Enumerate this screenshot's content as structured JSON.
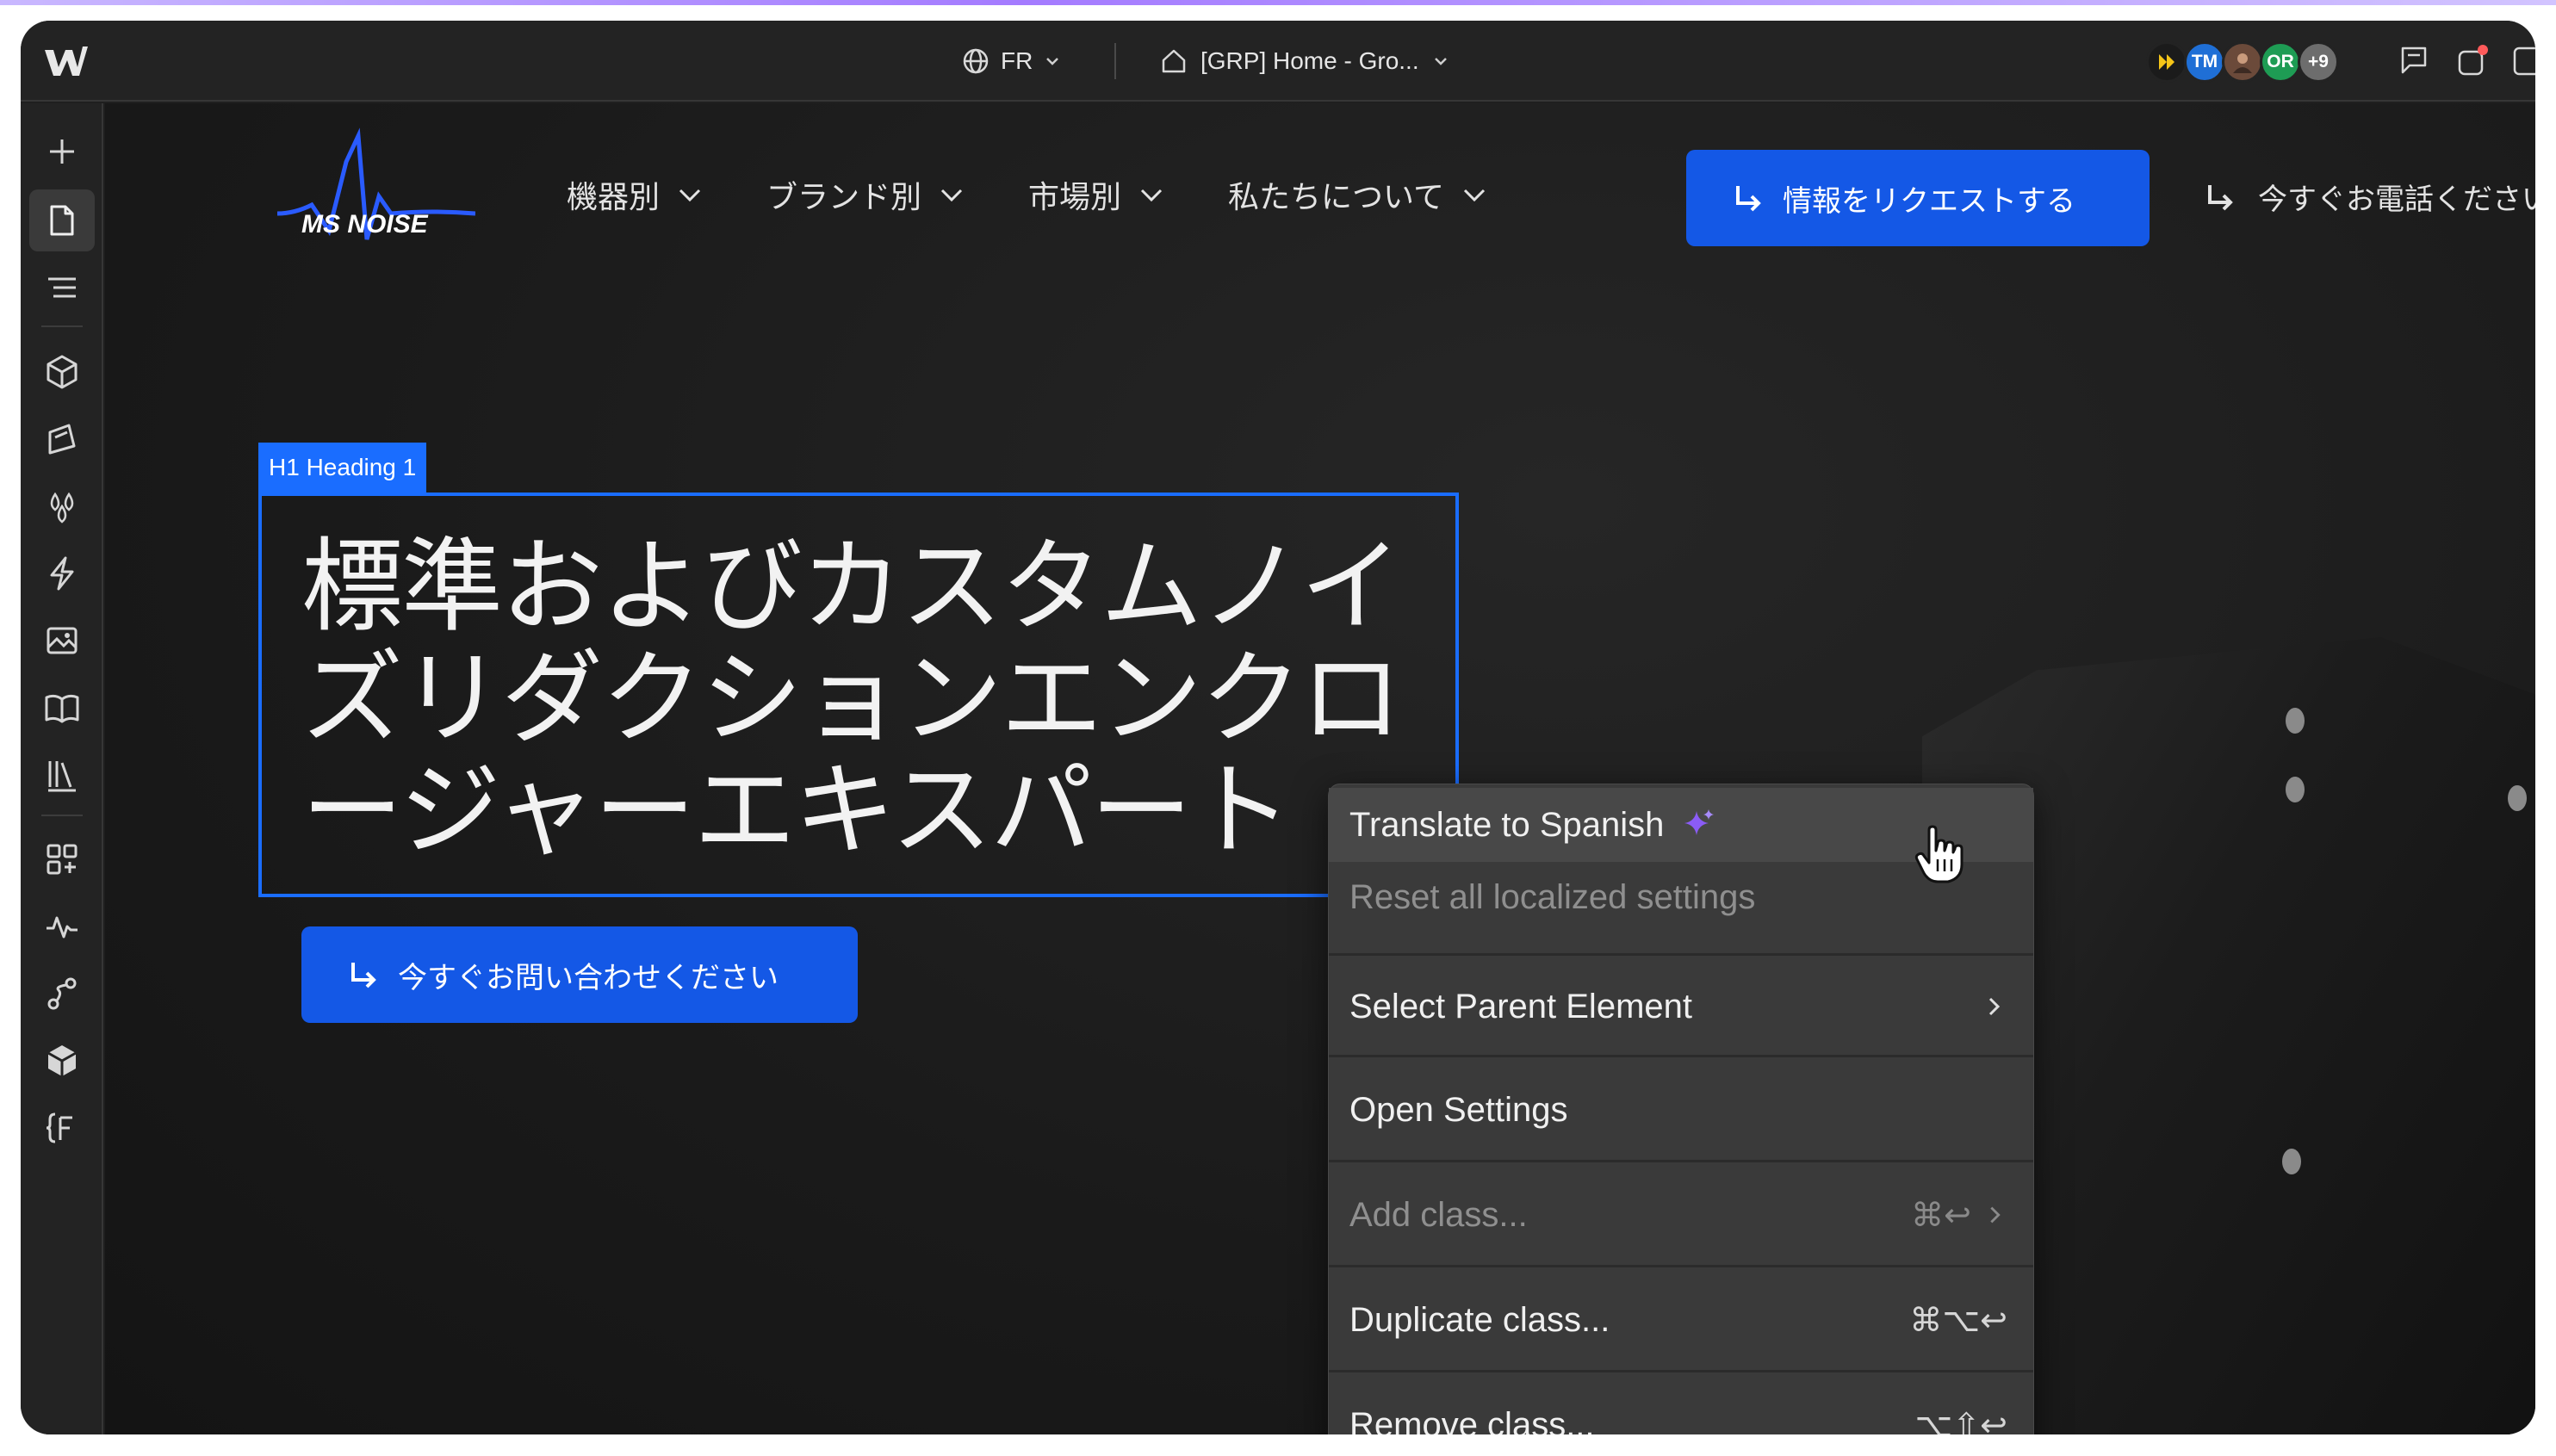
{
  "topbar": {
    "locale": "FR",
    "page_selector": "[GRP] Home - Gro...",
    "avatars": [
      {
        "initials": "",
        "color": "#1b1b1b"
      },
      {
        "initials": "TM",
        "color": "#1f6fd6"
      },
      {
        "initials": "",
        "color": "#6b4a3a"
      },
      {
        "initials": "OR",
        "color": "#1e9c54"
      },
      {
        "initials": "+9",
        "color": "#6d6d6d"
      }
    ]
  },
  "sidebar": {
    "items": [
      "add-icon",
      "pages-icon",
      "navigator-icon",
      "components-icon",
      "style-icon",
      "variables-icon",
      "interactions-icon",
      "assets-icon",
      "cms-icon",
      "library-icon",
      "apps-icon",
      "audit-icon",
      "logic-icon",
      "packages-icon",
      "fonts-icon"
    ]
  },
  "site": {
    "logo_text": "MS NOISE",
    "nav": [
      {
        "label": "機器別"
      },
      {
        "label": "ブランド別"
      },
      {
        "label": "市場別"
      },
      {
        "label": "私たちについて"
      }
    ],
    "request_button": "情報をリクエストする",
    "call_link": "今すぐお電話ください",
    "h1_tag": "H1 Heading 1",
    "heading": "標準およびカスタムノイズリダクションエンクロージャーエキスパート",
    "contact_button": "今すぐお問い合わせください"
  },
  "context_menu": {
    "translate": "Translate to Spanish",
    "reset": "Reset all localized settings",
    "select_parent": "Select Parent Element",
    "open_settings": "Open Settings",
    "add_class": "Add class...",
    "add_class_shortcut": "⌘↩",
    "duplicate_class": "Duplicate class...",
    "duplicate_class_shortcut": "⌘⌥↩",
    "remove_class": "Remove class...",
    "remove_class_shortcut": "⌥⇧↩"
  },
  "colors": {
    "accent_blue": "#1458e6",
    "selection_blue": "#1a6dff",
    "ai_sparkle": "#8b5cf6"
  }
}
